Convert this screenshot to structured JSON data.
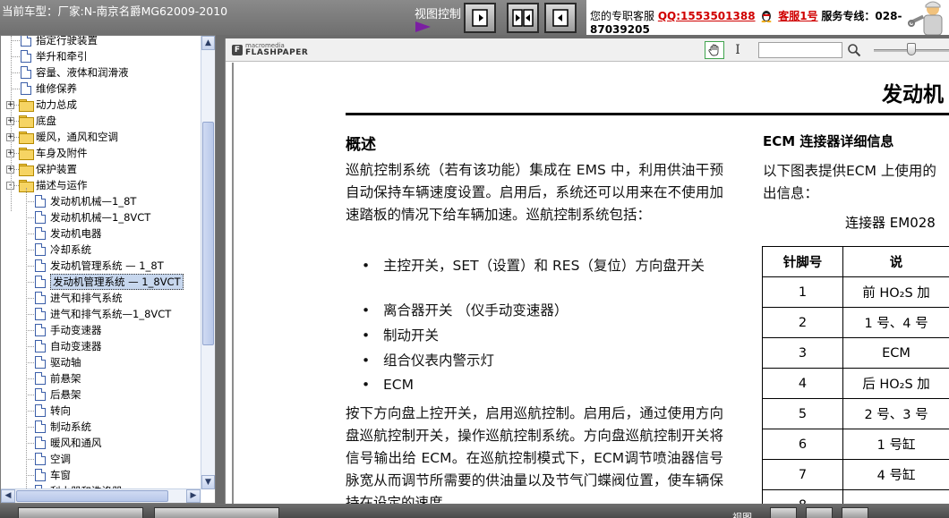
{
  "header": {
    "car_title": "当前车型：厂家:N-南京名爵MG62009-2010",
    "view_control_label": "视图控制",
    "view_buttons": [
      "single-page-icon",
      "two-page-icon",
      "prev-page-icon"
    ],
    "contact": {
      "prefix": "您的专职客服",
      "qq": "QQ:1553501388",
      "service": "客服1号",
      "hotline_label": "服务专线：028-",
      "hotline_cont": "87039205"
    }
  },
  "tree": {
    "items": [
      {
        "label": "指定行驶装置",
        "type": "doc",
        "level": 1,
        "partial": true
      },
      {
        "label": "举升和牵引",
        "type": "doc",
        "level": 1
      },
      {
        "label": "容量、液体和润滑液",
        "type": "doc",
        "level": 1
      },
      {
        "label": "维修保养",
        "type": "doc",
        "level": 1
      },
      {
        "label": "动力总成",
        "type": "folder",
        "level": 0,
        "expander": "+"
      },
      {
        "label": "底盘",
        "type": "folder",
        "level": 0,
        "expander": "+"
      },
      {
        "label": "暖风，通风和空调",
        "type": "folder",
        "level": 0,
        "expander": "+"
      },
      {
        "label": "车身及附件",
        "type": "folder",
        "level": 0,
        "expander": "+"
      },
      {
        "label": "保护装置",
        "type": "folder",
        "level": 0,
        "expander": "+"
      },
      {
        "label": "描述与运作",
        "type": "folder",
        "level": 0,
        "expander": "-"
      },
      {
        "label": "发动机机械—1_8T",
        "type": "doc",
        "level": 2
      },
      {
        "label": "发动机机械—1_8VCT",
        "type": "doc",
        "level": 2
      },
      {
        "label": "发动机电器",
        "type": "doc",
        "level": 2
      },
      {
        "label": "冷却系统",
        "type": "doc",
        "level": 2
      },
      {
        "label": "发动机管理系统 — 1_8T",
        "type": "doc",
        "level": 2
      },
      {
        "label": "发动机管理系统 — 1_8VCT",
        "type": "doc",
        "level": 2,
        "selected": true
      },
      {
        "label": "进气和排气系统",
        "type": "doc",
        "level": 2
      },
      {
        "label": "进气和排气系统—1_8VCT",
        "type": "doc",
        "level": 2
      },
      {
        "label": "手动变速器",
        "type": "doc",
        "level": 2
      },
      {
        "label": "自动变速器",
        "type": "doc",
        "level": 2
      },
      {
        "label": "驱动轴",
        "type": "doc",
        "level": 2
      },
      {
        "label": "前悬架",
        "type": "doc",
        "level": 2
      },
      {
        "label": "后悬架",
        "type": "doc",
        "level": 2
      },
      {
        "label": "转向",
        "type": "doc",
        "level": 2
      },
      {
        "label": "制动系统",
        "type": "doc",
        "level": 2
      },
      {
        "label": "暖风和通风",
        "type": "doc",
        "level": 2
      },
      {
        "label": "空调",
        "type": "doc",
        "level": 2
      },
      {
        "label": "车窗",
        "type": "doc",
        "level": 2
      },
      {
        "label": "刮水器和洗涤器",
        "type": "doc",
        "level": 2,
        "partial": true
      }
    ]
  },
  "viewer": {
    "brand_line1": "macromedia",
    "brand_line2": "FLASHPAPER",
    "find_value": ""
  },
  "document": {
    "title": "发动机",
    "overview_heading": "概述",
    "p1": "巡航控制系统（若有该功能）集成在 EMS 中，利用供油干预自动保持车辆速度设置。启用后，系统还可以用来在不使用加速踏板的情况下给车辆加速。巡航控制系统包括：",
    "bullets": [
      "主控开关，SET（设置）和 RES（复位）方向盘开关",
      "离合器开关 （仪手动变速器）",
      "制动开关",
      "组合仪表内警示灯",
      "ECM"
    ],
    "p2": "按下方向盘上控开关，启用巡航控制。启用后，通过使用方向盘巡航控制开关，操作巡航控制系统。方向盘巡航控制开关将信号输出给 ECM。在巡航控制模式下，ECM调节喷油器信号脉宽从而调节所需要的供油量以及节气门蝶阀位置，使车辆保持在设定的速度。",
    "ecm_heading": "ECM 连接器详细信息",
    "ecm_text_1": "以下图表提供ECM 上使用的",
    "ecm_text_2": "出信息：",
    "connector": "连接器 EM028",
    "table": {
      "headers": [
        "针脚号",
        "说"
      ],
      "rows": [
        [
          "1",
          "前 HO₂S 加"
        ],
        [
          "2",
          "1 号、4 号"
        ],
        [
          "3",
          "ECM"
        ],
        [
          "4",
          "后 HO₂S 加"
        ],
        [
          "5",
          "2 号、3 号"
        ],
        [
          "6",
          "1 号缸"
        ],
        [
          "7",
          "4 号缸"
        ],
        [
          "8",
          ""
        ]
      ]
    }
  },
  "bottom": {
    "label": "视图"
  }
}
